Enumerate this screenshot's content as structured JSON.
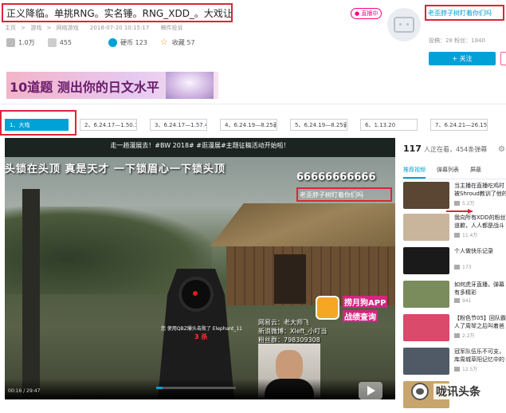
{
  "header": {
    "title": "正义降临。单挑RNG。实名锤。RNG_XDD_。大戏让你爽翻",
    "breadcrumb": [
      "主页",
      "游戏",
      "网络游戏"
    ],
    "date": "2018-07-20 10:15:17",
    "report": "稿件投诉"
  },
  "stats": {
    "views": "1.0万",
    "danmaku": "455",
    "coins": "硬币 123",
    "collect": "收藏 57"
  },
  "uploader": {
    "live_badge": "● 直播中",
    "name": "老歪脖子树盯着你们吗",
    "stats": "投稿：28    粉丝：1840",
    "follow": "+ 关注"
  },
  "banner": {
    "text": "10道题 测出你的日文水平"
  },
  "parts": [
    {
      "label": "1、大戏",
      "active": true
    },
    {
      "label": "2、6.24.17—1.50.1",
      "active": false
    },
    {
      "label": "3、6.24.17—1.57.40",
      "active": false
    },
    {
      "label": "4、6.24.19—8.25弱",
      "active": false
    },
    {
      "label": "5、6.24.19—8.25弱",
      "active": false
    },
    {
      "label": "6、1.13.20",
      "active": false
    },
    {
      "label": "7、6.24.21—26.15",
      "active": false
    }
  ],
  "player": {
    "video_title": "走一趟漫展去！#BW 2018# #逛漫展#主题征稿活动开始啦！",
    "big_subtitle": "头锁在头顶     真是天才    一下锁眉心一下锁头顶",
    "sixes": "66666666666",
    "highlight_danmaku": "老歪脖子树盯着你们吗",
    "kill_feed": "您 使用QBZ爆头击败了 Elephant_11",
    "kill_count": "3 杀",
    "app_line1": "捞月狗APP",
    "app_line2": "战绩查询",
    "streamer_lines": [
      "网易云：老大师飞",
      "新浪微博：Xleft_小叮当",
      "粉丝群：798309308"
    ],
    "time": "00:16 / 29:47"
  },
  "sidebar": {
    "count": "117",
    "watching": "人正在看，454条弹幕",
    "tabs": [
      "推荐视频",
      "弹幕列表",
      "屏蔽"
    ],
    "recs": [
      {
        "title": "当主播在直播吃鸡时被Shroud教训了他的首",
        "views": "5.2万",
        "color": "#5a4632"
      },
      {
        "title": "我向所有XDD的粉丝道歉，人人都是战斗的人",
        "views": "11.4万",
        "color": "#c9b59c"
      },
      {
        "title": "个人做快乐记录",
        "views": "173",
        "color": "#1a1a1a"
      },
      {
        "title": "如何虎牙直播，弹幕有多精彩",
        "views": "941",
        "color": "#7a8b5c"
      },
      {
        "title": "【粉色节05】回队霸人了周琴之后叫着爸爸",
        "views": "2.2万",
        "color": "#d94a6b"
      },
      {
        "title": "冠军队伍乐不可支，库周城草阳记忆中的乐",
        "views": "12.5万",
        "color": "#4f5a66"
      },
      {
        "title": "",
        "views": "",
        "color": "#c9a56e"
      }
    ]
  },
  "watermark": "咙讯头条"
}
